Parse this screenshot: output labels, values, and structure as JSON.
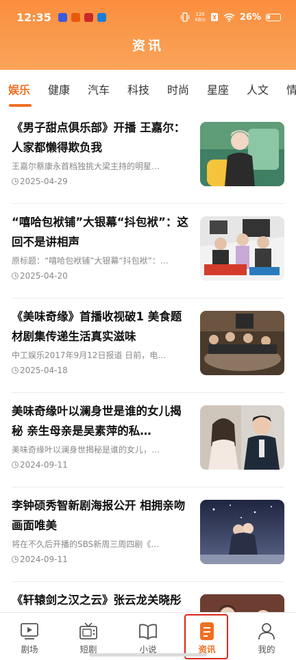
{
  "status_bar": {
    "time": "12:35",
    "net_speed_value": "126",
    "net_speed_unit": "KB/s",
    "battery": "26%"
  },
  "header": {
    "title": "资讯"
  },
  "tabs": [
    {
      "label": "娱乐",
      "active": true
    },
    {
      "label": "健康"
    },
    {
      "label": "汽车"
    },
    {
      "label": "科技"
    },
    {
      "label": "时尚"
    },
    {
      "label": "星座"
    },
    {
      "label": "人文"
    },
    {
      "label": "情"
    }
  ],
  "news": [
    {
      "title": "《男子甜点俱乐部》开播 王嘉尔：人家都懒得欺负我",
      "summary": "王嘉尔蔡康永首档独挑大梁主持的明星…",
      "date": "2025-04-29"
    },
    {
      "title": "“嘻哈包袱铺”大银幕“抖包袱”：这回不是讲相声",
      "summary": "原标题：“嘻哈包袱铺”大银幕“抖包袱”：…",
      "date": "2025-04-20"
    },
    {
      "title": "《美味奇缘》首播收视破1 美食题材剧集传递生活真实滋味",
      "summary": "中工娱乐2017年9月12日报道 日前，电…",
      "date": "2025-04-18"
    },
    {
      "title": "美味奇缘叶以澜身世是谁的女儿揭秘 亲生母亲是吴素萍的私…",
      "summary": "美味奇缘叶以澜身世揭秘是谁的女儿，…",
      "date": "2024-09-11"
    },
    {
      "title": "李钟硕秀智新剧海报公开 相拥亲吻画面唯美",
      "summary": "将在不久后开播的SBS新周三周四剧《…",
      "date": "2024-09-11"
    },
    {
      "title": "《轩辕剑之汉之云》张云龙关晓彤张佳宁恋情虐心",
      "summary": "",
      "date": ""
    }
  ],
  "bottom_nav": [
    {
      "label": "剧场",
      "icon": "play-screen-icon"
    },
    {
      "label": "短剧",
      "icon": "tv-icon"
    },
    {
      "label": "小说",
      "icon": "book-icon"
    },
    {
      "label": "资讯",
      "icon": "document-icon",
      "active": true
    },
    {
      "label": "我的",
      "icon": "user-icon"
    }
  ],
  "colors": {
    "accent": "#f06f23",
    "header_gradient_top": "#fb8e3e",
    "header_gradient_bottom": "#f9a45a",
    "highlight_border": "#d9251c"
  }
}
